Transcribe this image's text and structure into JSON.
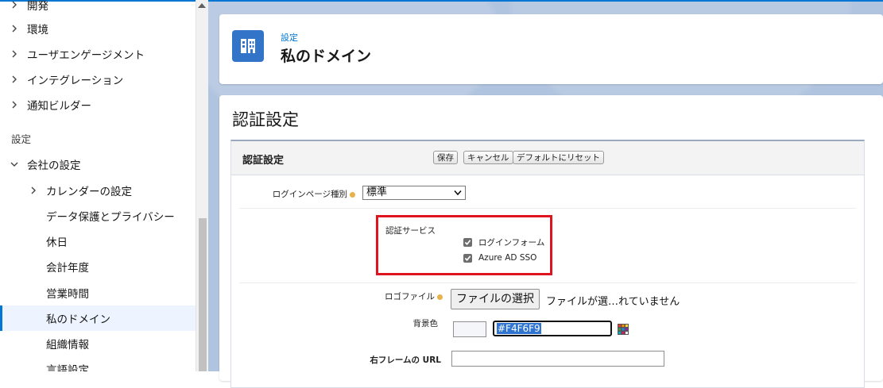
{
  "sidebar": {
    "top_items": [
      {
        "label": "開発"
      },
      {
        "label": "環境"
      },
      {
        "label": "ユーザエンゲージメント"
      },
      {
        "label": "インテグレーション"
      },
      {
        "label": "通知ビルダー"
      }
    ],
    "section_label": "設定",
    "group": {
      "label": "会社の設定"
    },
    "sub_items": [
      {
        "label": "カレンダーの設定",
        "expandable": true
      },
      {
        "label": "データ保護とプライバシー"
      },
      {
        "label": "休日"
      },
      {
        "label": "会計年度"
      },
      {
        "label": "営業時間"
      },
      {
        "label": "私のドメイン",
        "selected": true
      },
      {
        "label": "組織情報"
      },
      {
        "label": "言語設定"
      }
    ]
  },
  "header": {
    "breadcrumb": "設定",
    "title": "私のドメイン",
    "icon": "building-icon",
    "icon_color": "#3274c7"
  },
  "content": {
    "title": "認証設定",
    "section": {
      "title": "認証設定",
      "buttons": {
        "save": "保存",
        "cancel": "キャンセル",
        "reset": "デフォルトにリセット"
      },
      "login_page_type": {
        "label": "ログインページ種別",
        "value": "標準"
      },
      "auth_service": {
        "label": "認証サービス",
        "options": [
          {
            "label": "ログインフォーム",
            "checked": true
          },
          {
            "label": "Azure AD SSO",
            "checked": true
          }
        ],
        "highlight_color": "#e0141e"
      },
      "logo_file": {
        "label": "ロゴファイル",
        "button": "ファイルの選択",
        "status": "ファイルが選…れていません"
      },
      "background_color": {
        "label": "背景色",
        "value": "#F4F6F9"
      },
      "right_frame_url": {
        "label": "右フレームの URL",
        "value": ""
      }
    }
  },
  "colors": {
    "accent": "#0176d3",
    "backdrop": "#b0c4df"
  }
}
